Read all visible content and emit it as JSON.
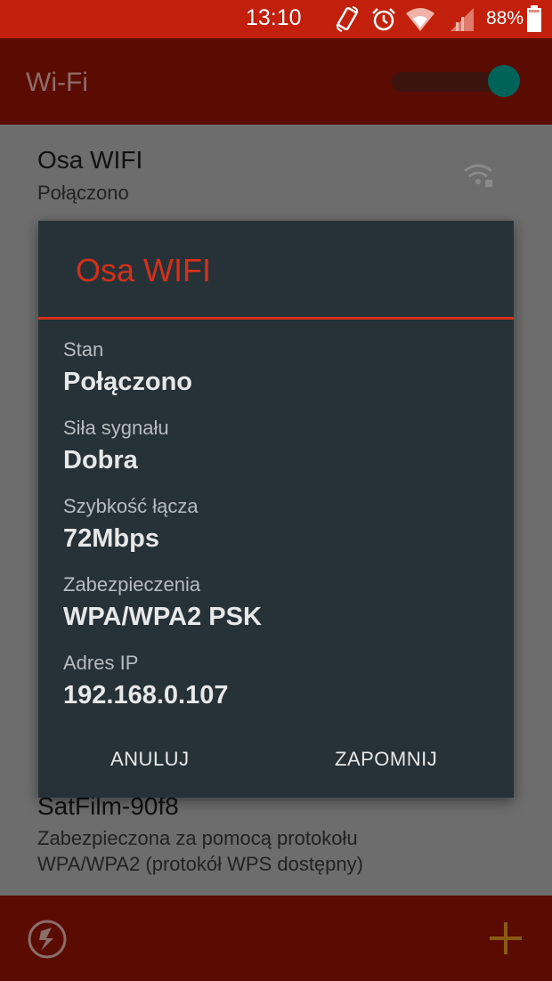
{
  "status_bar": {
    "time": "13:10",
    "battery": "88%",
    "icons": [
      "rotate-icon",
      "alarm-icon",
      "wifi-icon",
      "cell-signal-icon",
      "battery-icon"
    ]
  },
  "app_bar": {
    "title": "Wi-Fi",
    "wifi_enabled": true
  },
  "networks": [
    {
      "name": "Osa WIFI",
      "status": "Połączono"
    },
    {
      "name": "SatFilm-90f8",
      "status_line1": "Zabezpieczona za pomocą protokołu",
      "status_line2": "WPA/WPA2 (protokół WPS dostępny)"
    }
  ],
  "dialog": {
    "title": "Osa WIFI",
    "fields": [
      {
        "label": "Stan",
        "value": "Połączono"
      },
      {
        "label": "Siła sygnału",
        "value": "Dobra"
      },
      {
        "label": "Szybkość łącza",
        "value": "72Mbps"
      },
      {
        "label": "Zabezpieczenia",
        "value": "WPA/WPA2 PSK"
      },
      {
        "label": "Adres IP",
        "value": "192.168.0.107"
      }
    ],
    "cancel_label": "ANULUJ",
    "forget_label": "ZAPOMNIJ"
  },
  "bottom_bar": {
    "icons": [
      "refresh-icon",
      "add-icon"
    ]
  },
  "colors": {
    "status_bar": "#c2200c",
    "app_bar": "#5a0c03",
    "accent": "#d4301a",
    "dialog_bg": "#263238",
    "toggle_thumb": "#00635a",
    "add_icon": "#8a5a14"
  }
}
